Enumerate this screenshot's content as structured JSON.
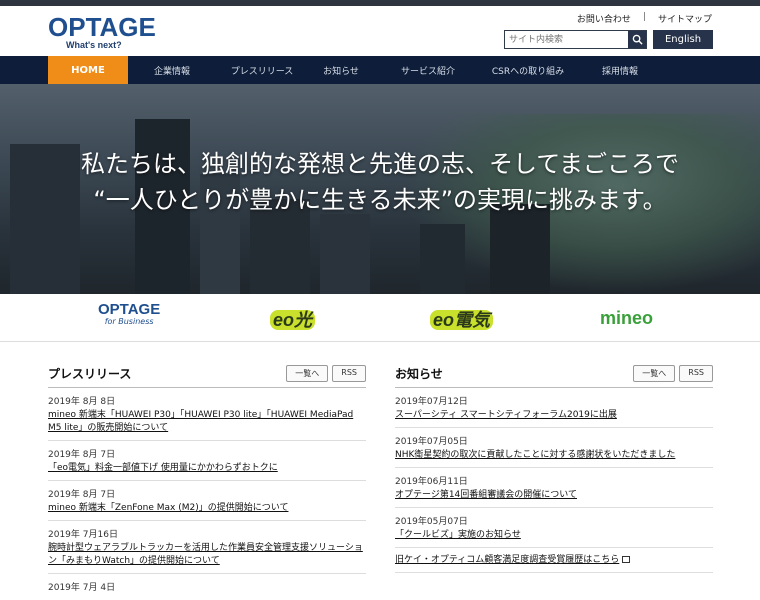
{
  "header": {
    "logo_name": "OPTAGE",
    "logo_tagline": "What's next?",
    "links": [
      "お問い合わせ",
      "サイトマップ"
    ],
    "search_placeholder": "サイト内検索",
    "english_label": "English"
  },
  "nav": {
    "items": [
      "HOME",
      "企業情報",
      "プレスリリース",
      "お知らせ",
      "サービス紹介",
      "CSRへの取り組み",
      "採用情報"
    ]
  },
  "hero": {
    "line1": "私たちは、独創的な発想と先進の志、そしてまごころで",
    "line2": "“一人ひとりが豊かに生きる未来”の実現に挑みます。"
  },
  "brands": {
    "b1_name": "OPTAGE",
    "b1_sub": "for Business",
    "b2": "eo光",
    "b3": "eo電気",
    "b4": "mineo"
  },
  "press": {
    "title": "プレスリリース",
    "list_btn": "一覧へ",
    "rss_btn": "RSS",
    "items": [
      {
        "date": "2019年 8月 8日",
        "text": "mineo 新端末「HUAWEI P30」「HUAWEI P30 lite」「HUAWEI MediaPad M5 lite」の販売開始について"
      },
      {
        "date": "2019年 8月 7日",
        "text": "「eo電気」料金一部値下げ 使用量にかかわらずおトクに"
      },
      {
        "date": "2019年 8月 7日",
        "text": "mineo 新端末「ZenFone Max (M2)」の提供開始について"
      },
      {
        "date": "2019年 7月16日",
        "text": "腕時計型ウェアラブルトラッカーを活用した作業員安全管理支援ソリューション「みまもりWatch」の提供開始について"
      },
      {
        "date": "2019年 7月 4日",
        "text": ""
      }
    ]
  },
  "news": {
    "title": "お知らせ",
    "list_btn": "一覧へ",
    "rss_btn": "RSS",
    "items": [
      {
        "date": "2019年07月12日",
        "text": "スーパーシティ スマートシティフォーラム2019に出展"
      },
      {
        "date": "2019年07月05日",
        "text": "NHK衛星契約の取次に貢献したことに対する感謝状をいただきました"
      },
      {
        "date": "2019年06月11日",
        "text": "オプテージ第14回番組審議会の開催について"
      },
      {
        "date": "2019年05月07日",
        "text": "「クールビズ」実施のお知らせ"
      }
    ],
    "extra": "旧ケイ・オプティコム顧客満足度調査受賞履歴はこちら"
  }
}
